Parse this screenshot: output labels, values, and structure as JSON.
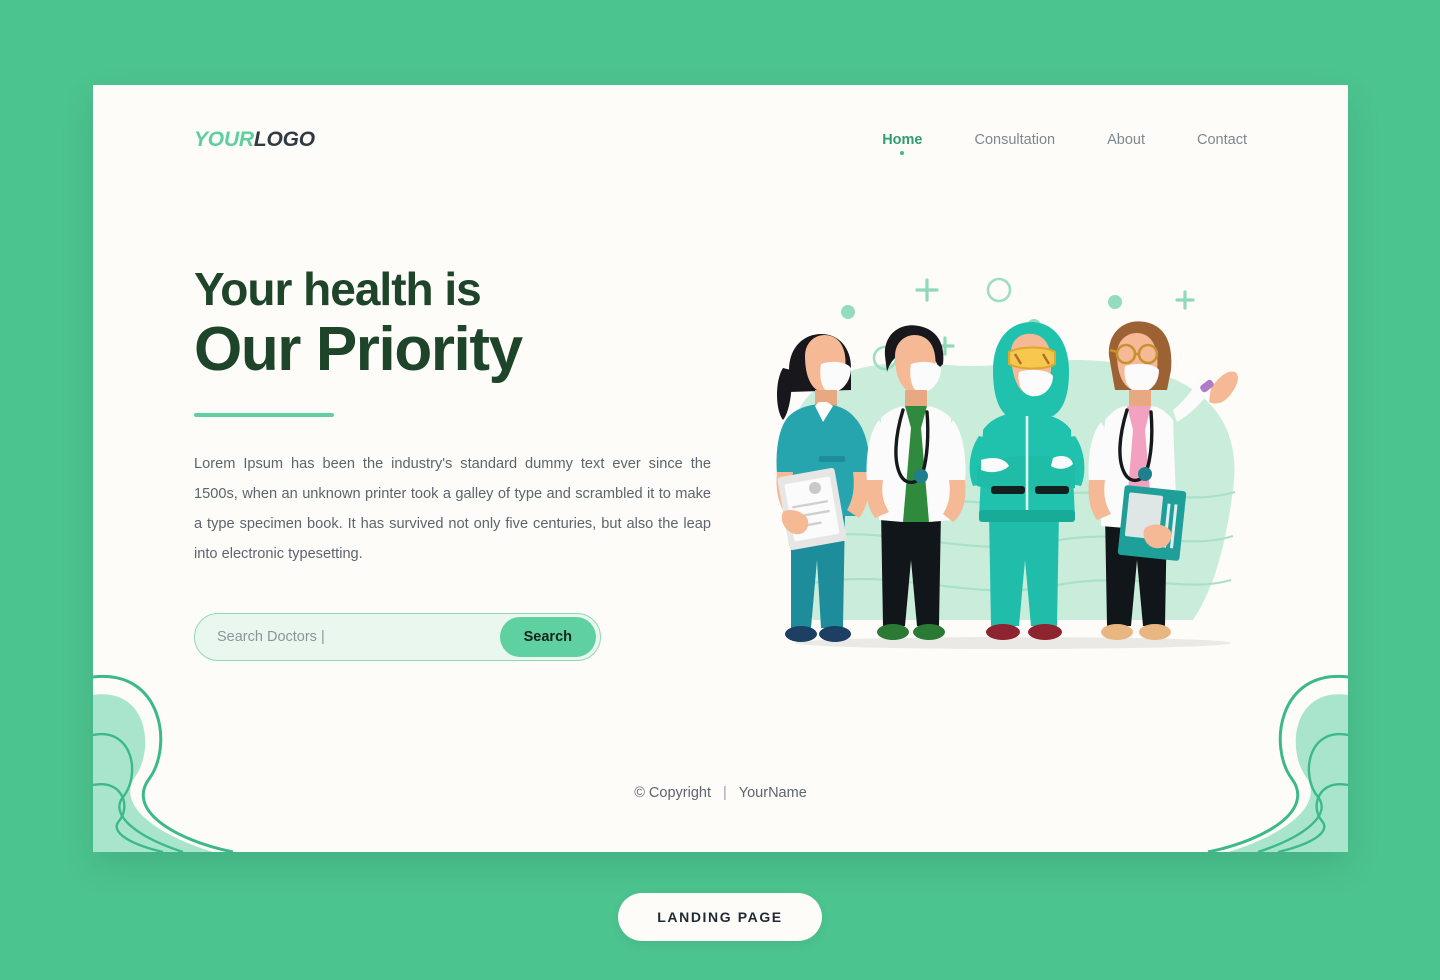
{
  "page": {
    "background_color": "#4cc490",
    "card_color": "#fefcf8",
    "accent_green": "#5ecf9e",
    "dark_green": "#1e4429",
    "muted_text": "#5c656d"
  },
  "header": {
    "logo": {
      "part1": "YOUR",
      "part2": "LOGO"
    },
    "nav": [
      {
        "label": "Home",
        "active": true
      },
      {
        "label": "Consultation",
        "active": false
      },
      {
        "label": "About",
        "active": false
      },
      {
        "label": "Contact",
        "active": false
      }
    ]
  },
  "hero": {
    "headline_line1": "Your health is",
    "headline_line2": "Our Priority",
    "paragraph": "Lorem Ipsum has been the industry's standard dummy text ever since the 1500s, when an unknown printer took a galley of type and scrambled it to make a type specimen book. It has survived not only five centuries, but also the leap into electronic typesetting."
  },
  "search": {
    "placeholder": "Search Doctors |",
    "value": "",
    "button_label": "Search"
  },
  "footer": {
    "copyright": "© Copyright",
    "separator": "|",
    "name": "YourName"
  },
  "landing_button": {
    "label": "LANDING PAGE"
  },
  "illustration": {
    "description": "Four masked medical workers standing in front of a mint green blob",
    "characters": [
      {
        "name": "nurse-teal-scrubs",
        "uniform_color": "#2d9fa8",
        "holding": "clipboard"
      },
      {
        "name": "doctor-white-coat-green-scrubs",
        "uniform_color": "#ffffff",
        "holding": "stethoscope"
      },
      {
        "name": "worker-hazmat-suit",
        "uniform_color": "#20c2ae",
        "holding": "none"
      },
      {
        "name": "doctor-glasses-pink-top",
        "uniform_color": "#ffffff",
        "holding": "folder"
      }
    ],
    "decor": [
      "plus",
      "circle-outline",
      "dot"
    ]
  }
}
